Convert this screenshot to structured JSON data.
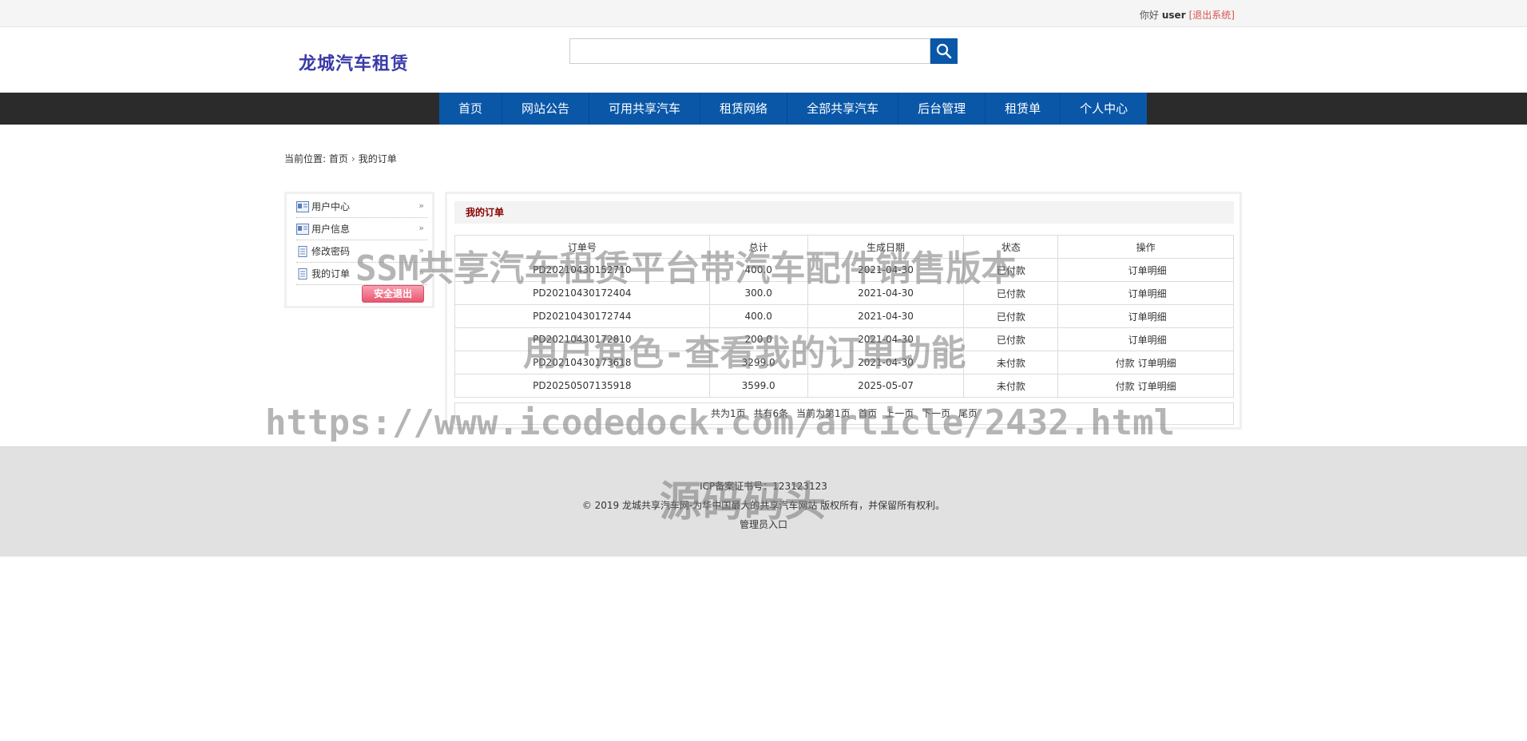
{
  "topbar": {
    "greeting": "你好",
    "username": "user",
    "logout_link": "[退出系统]"
  },
  "header": {
    "logo": "龙城汽车租赁",
    "search_value": ""
  },
  "nav": {
    "items": [
      "首页",
      "网站公告",
      "可用共享汽车",
      "租赁网络",
      "全部共享汽车",
      "后台管理",
      "租赁单",
      "个人中心"
    ]
  },
  "breadcrumb": {
    "prefix": "当前位置:",
    "home": "首页",
    "sep": "›",
    "current": "我的订单"
  },
  "sidebar": {
    "items": [
      "用户中心",
      "用户信息",
      "修改密码",
      "我的订单"
    ],
    "arrow": "»",
    "logout_button": "安全退出"
  },
  "orders": {
    "title": "我的订单",
    "headers": [
      "订单号",
      "总计",
      "生成日期",
      "状态",
      "操作"
    ],
    "rows": [
      {
        "id": "PD20210430152710",
        "total": "400.0",
        "date": "2021-04-30",
        "status": "已付款",
        "pay": "",
        "detail": "订单明细"
      },
      {
        "id": "PD20210430172404",
        "total": "300.0",
        "date": "2021-04-30",
        "status": "已付款",
        "pay": "",
        "detail": "订单明细"
      },
      {
        "id": "PD20210430172744",
        "total": "400.0",
        "date": "2021-04-30",
        "status": "已付款",
        "pay": "",
        "detail": "订单明细"
      },
      {
        "id": "PD20210430172810",
        "total": "200.0",
        "date": "2021-04-30",
        "status": "已付款",
        "pay": "",
        "detail": "订单明细"
      },
      {
        "id": "PD20210430173618",
        "total": "3299.0",
        "date": "2021-04-30",
        "status": "未付款",
        "pay": "付款",
        "detail": "订单明细"
      },
      {
        "id": "PD20250507135918",
        "total": "3599.0",
        "date": "2025-05-07",
        "status": "未付款",
        "pay": "付款",
        "detail": "订单明细"
      }
    ],
    "pager": {
      "total_pages": "共为1页",
      "total_items": "共有6条",
      "current": "当前为第1页",
      "first": "首页",
      "prev": "上一页",
      "next": "下一页",
      "last": "尾页"
    }
  },
  "footer": {
    "icp": "ICP备案证书号：123123123",
    "copyright": "© 2019 龙城共享汽车网-为华中国最大的共享汽车网站 版权所有，并保留所有权利。",
    "admin_link": "管理员入口"
  },
  "watermark": {
    "line1": "SSM共享汽车租赁平台带汽车配件销售版本",
    "line2": "用户角色-查看我的订单功能",
    "url": "https://www.icodedock.com/article/2432.html",
    "brand": "源码码头"
  },
  "colors": {
    "nav_blue": "#0a57a8",
    "nav_dark": "#2b2b2b",
    "logo": "#3a3aa8",
    "title_red": "#8b0000",
    "logout_link": "#d9534f"
  }
}
